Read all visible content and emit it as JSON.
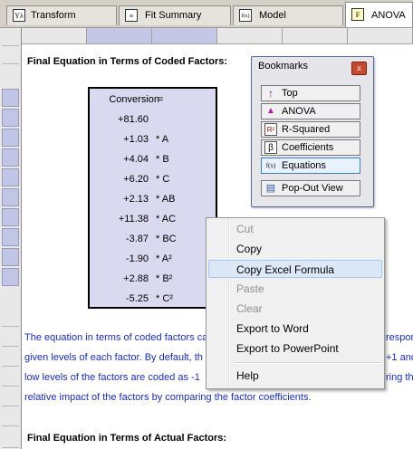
{
  "tabs": [
    {
      "label": "Transform",
      "icon": "Yλ"
    },
    {
      "label": "Fit Summary",
      "icon": "≡"
    },
    {
      "label": "Model",
      "icon": "f(x)"
    },
    {
      "label": "ANOVA",
      "icon": "F"
    }
  ],
  "coded": {
    "heading": "Final Equation in Terms of Coded Factors:",
    "response": "Conversion",
    "equals": "=",
    "terms": [
      {
        "coef": "+81.60",
        "term": ""
      },
      {
        "coef": "+1.03",
        "term": "* A"
      },
      {
        "coef": "+4.04",
        "term": "* B"
      },
      {
        "coef": "+6.20",
        "term": "* C"
      },
      {
        "coef": "+2.13",
        "term": "* AB"
      },
      {
        "coef": "+11.38",
        "term": "* AC"
      },
      {
        "coef": "-3.87",
        "term": "* BC"
      },
      {
        "coef": "-1.90",
        "term": "* A²"
      },
      {
        "coef": "+2.88",
        "term": "* B²"
      },
      {
        "coef": "-5.25",
        "term": "* C²"
      }
    ]
  },
  "paragraph": {
    "line1": "The equation in terms of coded factors ca",
    "line1_tail": "respon",
    "line2": "given levels of each factor.  By default, th",
    "line2_tail": "+1 and",
    "line3": "low levels of the factors are coded as -1",
    "line3_tail": "ring the",
    "line4": "relative impact of the factors by comparing the factor coefficients."
  },
  "actual": {
    "heading": "Final Equation in Terms of Actual Factors:"
  },
  "bookmarks": {
    "title": "Bookmarks",
    "close": "x",
    "items": [
      {
        "label": "Top",
        "icon": "↑"
      },
      {
        "label": "ANOVA",
        "icon": "▲"
      },
      {
        "label": "R-Squared",
        "icon": "R²"
      },
      {
        "label": "Coefficients",
        "icon": "β"
      },
      {
        "label": "Equations",
        "icon": "f(x)"
      }
    ],
    "popout": {
      "label": "Pop-Out View",
      "icon": "▤"
    }
  },
  "context_menu": {
    "items": [
      {
        "label": "Cut",
        "enabled": false
      },
      {
        "label": "Copy",
        "enabled": true
      },
      {
        "label": "Copy Excel Formula",
        "enabled": true
      },
      {
        "label": "Paste",
        "enabled": false
      },
      {
        "label": "Clear",
        "enabled": false
      },
      {
        "label": "Export to Word",
        "enabled": true
      },
      {
        "label": "Export to PowerPoint",
        "enabled": true
      },
      {
        "label": "Help",
        "enabled": true
      }
    ]
  }
}
